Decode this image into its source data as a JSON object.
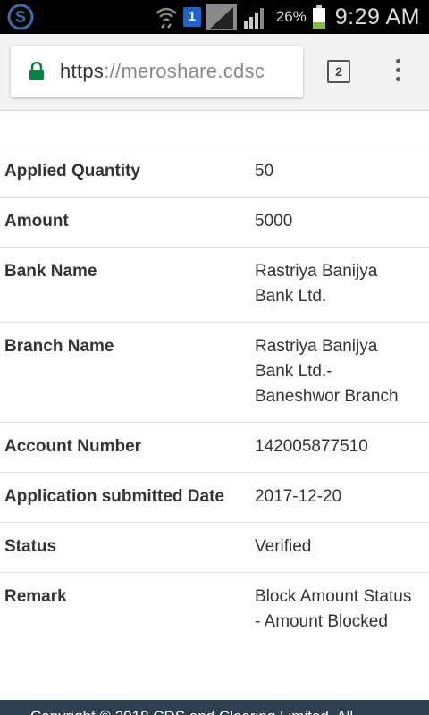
{
  "status_bar": {
    "notification_badge": "1",
    "battery_percent": "26%",
    "time": "9:29 AM"
  },
  "browser": {
    "url_scheme": "https",
    "url_rest": "://meroshare.cdsc",
    "tab_count": "2"
  },
  "details": [
    {
      "label": "Applied Quantity",
      "value": "50"
    },
    {
      "label": "Amount",
      "value": "5000"
    },
    {
      "label": "Bank Name",
      "value": "Rastriya Banijya Bank Ltd."
    },
    {
      "label": "Branch Name",
      "value": "Rastriya Banijya Bank Ltd.- Baneshwor Branch"
    },
    {
      "label": "Account Number",
      "value": "142005877510"
    },
    {
      "label": "Application submitted Date",
      "value": "2017-12-20"
    },
    {
      "label": "Status",
      "value": "Verified"
    },
    {
      "label": "Remark",
      "value": "Block Amount Status - Amount Blocked"
    }
  ],
  "footer": {
    "text": "Copyright © 2018 CDS and Clearing Limited. All"
  },
  "colors": {
    "footer_bg": "#2f3f4f",
    "lock_green": "#0b8043",
    "badge_blue": "#1e63c8"
  }
}
